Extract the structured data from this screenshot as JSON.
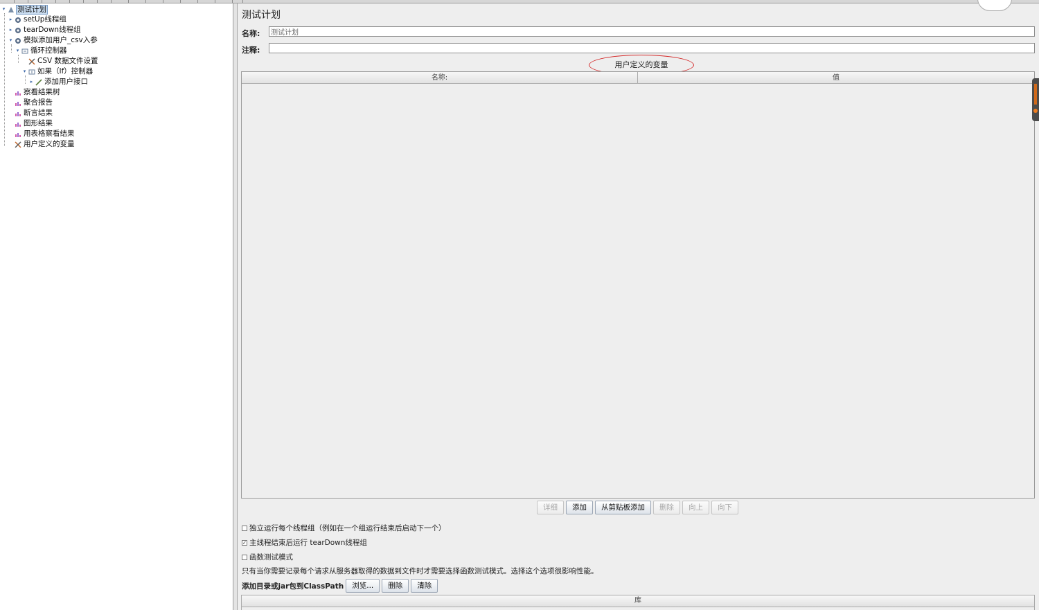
{
  "tree": {
    "nodes": [
      {
        "label": "测试计划",
        "icon": "test-plan-icon",
        "handle": "▾",
        "selected": true
      },
      {
        "label": "setUp线程组",
        "icon": "gear-icon",
        "handle": "▸"
      },
      {
        "label": "tearDown线程组",
        "icon": "gear-icon",
        "handle": "▸"
      },
      {
        "label": "模拟添加用户_csv入参",
        "icon": "gear-icon",
        "handle": "▾"
      },
      {
        "label": "循环控制器",
        "icon": "loop-controller-icon",
        "handle": "▾"
      },
      {
        "label": "CSV 数据文件设置",
        "icon": "config-scissors-icon",
        "handle": ""
      },
      {
        "label": "如果（If）控制器",
        "icon": "if-controller-icon",
        "handle": "▾"
      },
      {
        "label": "添加用户接口",
        "icon": "sampler-pen-icon",
        "handle": "▸"
      },
      {
        "label": "察看结果树",
        "icon": "listener-chart-icon",
        "handle": ""
      },
      {
        "label": "聚合报告",
        "icon": "listener-chart-icon",
        "handle": ""
      },
      {
        "label": "断言结果",
        "icon": "listener-chart-icon",
        "handle": ""
      },
      {
        "label": "图形结果",
        "icon": "listener-chart-icon",
        "handle": ""
      },
      {
        "label": "用表格察看结果",
        "icon": "listener-chart-icon",
        "handle": ""
      },
      {
        "label": "用户定义的变量",
        "icon": "config-scissors-icon",
        "handle": ""
      }
    ]
  },
  "panel": {
    "title": "测试计划",
    "name_label": "名称:",
    "name_value": "测试计划",
    "comment_label": "注释:",
    "comment_value": "",
    "section_title": "用户定义的变量",
    "table_columns": [
      "名称:",
      "值"
    ],
    "buttons": [
      {
        "label": "详细",
        "enabled": false
      },
      {
        "label": "添加",
        "enabled": true
      },
      {
        "label": "从剪贴板添加",
        "enabled": true
      },
      {
        "label": "删除",
        "enabled": false
      },
      {
        "label": "向上",
        "enabled": false
      },
      {
        "label": "向下",
        "enabled": false
      }
    ],
    "options": [
      {
        "label": "独立运行每个线程组（例如在一个组运行结束后启动下一个）",
        "checked": false
      },
      {
        "label": "主线程结束后运行 tearDown线程组",
        "checked": true
      },
      {
        "label": "函数测试模式",
        "checked": false
      }
    ],
    "functional_mode_description": "只有当你需要记录每个请求从服务器取得的数据到文件时才需要选择函数测试模式。选择这个选项很影响性能。",
    "classpath_label": "添加目录或jar包到ClassPath",
    "classpath_buttons": [
      "浏览...",
      "删除",
      "清除"
    ],
    "library_column": "库"
  },
  "colors": {
    "selection_bg": "#c9dcf0",
    "annotation_ellipse": "#d42a2a",
    "panel_bg": "#eeeeee"
  }
}
